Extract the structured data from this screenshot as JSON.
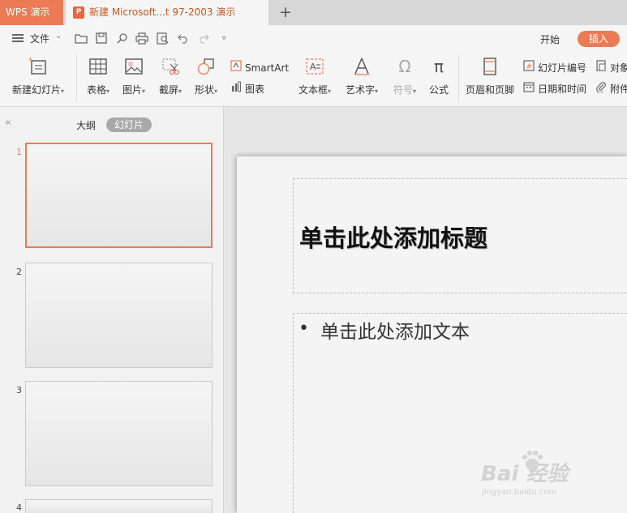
{
  "titlebar": {
    "app_tab": "WPS 演示",
    "doc_tab": "新建 Microsoft...t 97-2003 演示",
    "doc_icon_letter": "P",
    "new_tab_glyph": "+"
  },
  "quickbar": {
    "file_label": "文件",
    "tabs": {
      "start": "开始",
      "insert": "插入"
    },
    "icons": [
      "menu-icon",
      "open-folder-icon",
      "save-icon",
      "find-icon",
      "print-icon",
      "print-preview-icon",
      "undo-icon",
      "redo-icon",
      "customize-dropdown-icon"
    ]
  },
  "ribbon": {
    "new_slide": "新建幻灯片",
    "table": "表格",
    "picture": "图片",
    "screenshot": "截屏",
    "shapes": "形状",
    "smartart": "SmartArt",
    "chart": "图表",
    "textbox": "文本框",
    "wordart": "艺术字",
    "symbol": "符号",
    "formula": "公式",
    "header_footer": "页眉和页脚",
    "slide_number": "幻灯片编号",
    "object": "对象",
    "date_time": "日期和时间",
    "attachment": "附件"
  },
  "leftpane": {
    "view_outline": "大纲",
    "view_slides": "幻灯片",
    "slides": [
      {
        "number": "1",
        "selected": true
      },
      {
        "number": "2",
        "selected": false
      },
      {
        "number": "3",
        "selected": false
      },
      {
        "number": "4",
        "selected": false
      }
    ]
  },
  "slide": {
    "title_placeholder": "单击此处添加标题",
    "body_bullet": "•",
    "body_placeholder": "单击此处添加文本"
  },
  "watermark": {
    "logo": "Bai  经验",
    "url": "jingyan.baidu.com"
  },
  "colors": {
    "accent": "#ea7b55",
    "tab_text": "#c8571f",
    "ribbon_bg": "#f5f5f5",
    "canvas_bg": "#e6e6e6"
  }
}
